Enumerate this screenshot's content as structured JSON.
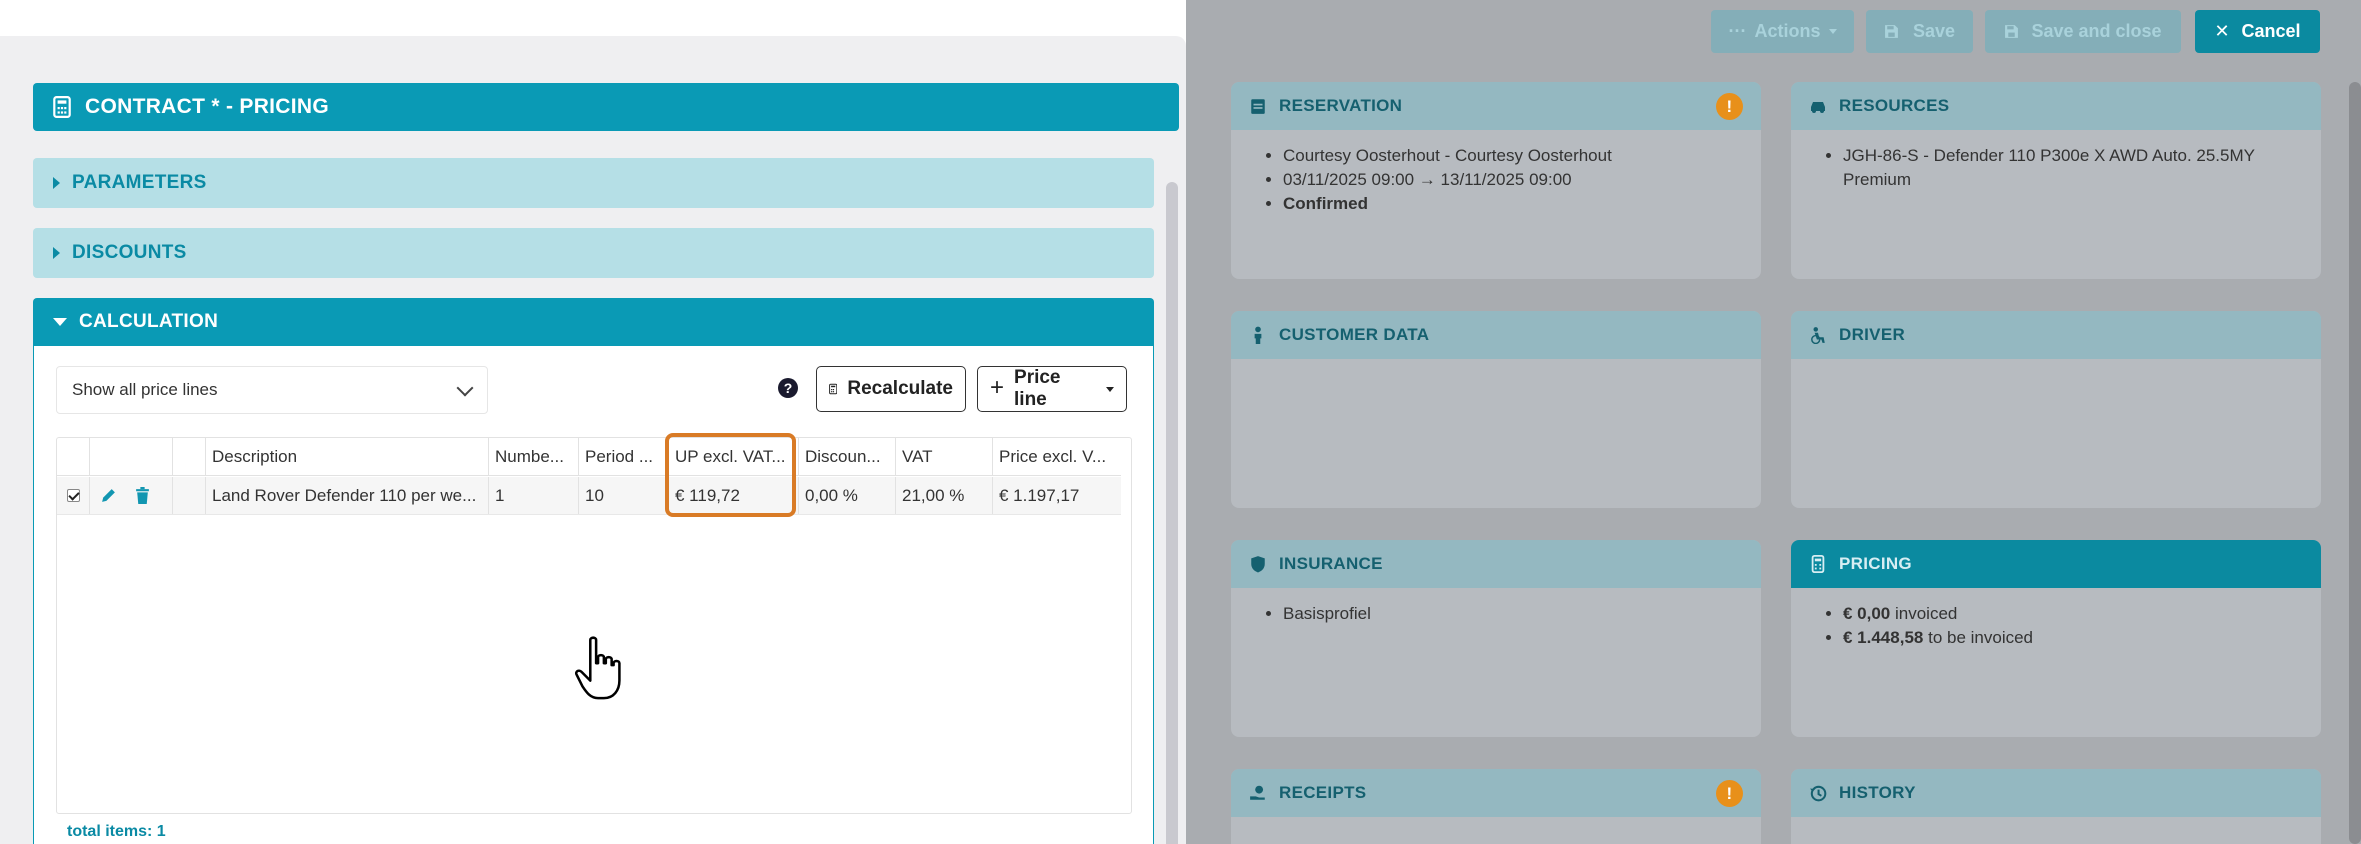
{
  "left": {
    "title": "CONTRACT * - PRICING",
    "sections": {
      "parameters": "PARAMETERS",
      "discounts": "DISCOUNTS",
      "calculation": "CALCULATION"
    },
    "filter_value": "Show all price lines",
    "buttons": {
      "recalculate": "Recalculate",
      "price_line": "Price line"
    },
    "help_symbol": "?",
    "table": {
      "headers": [
        "Description",
        "Numbe...",
        "Period ...",
        "UP excl. VAT...",
        "Discoun...",
        "VAT",
        "Price excl. V..."
      ],
      "rows": [
        {
          "checked": true,
          "description": "Land Rover Defender 110 per we...",
          "number": "1",
          "period": "10",
          "up_excl_vat": "€ 119,72",
          "discount": "0,00 %",
          "vat": "21,00 %",
          "price_excl_vat": "€ 1.197,17"
        }
      ]
    },
    "total_items": "total items: 1"
  },
  "right": {
    "toolbar": {
      "actions": "Actions",
      "save": "Save",
      "save_and_close": "Save and close",
      "cancel": "Cancel"
    },
    "cards": {
      "reservation": {
        "title": "RESERVATION",
        "items": [
          "Courtesy Oosterhout - Courtesy Oosterhout",
          "03/11/2025 09:00 → 13/11/2025 09:00",
          "Confirmed"
        ]
      },
      "resources": {
        "title": "RESOURCES",
        "items": [
          "JGH-86-S - Defender 110 P300e X AWD Auto. 25.5MY Premium"
        ]
      },
      "customer_data": {
        "title": "CUSTOMER DATA"
      },
      "driver": {
        "title": "DRIVER"
      },
      "insurance": {
        "title": "INSURANCE",
        "items": [
          "Basisprofiel"
        ]
      },
      "pricing": {
        "title": "PRICING",
        "invoiced_amount": "€ 0,00",
        "invoiced_label": "invoiced",
        "to_invoice_amount": "€ 1.448,58",
        "to_invoice_label": "to be invoiced"
      },
      "receipts": {
        "title": "RECEIPTS"
      },
      "history": {
        "title": "HISTORY"
      }
    },
    "warning_symbol": "!"
  },
  "colors": {
    "accent": "#0a9ab5",
    "accent_light": "#b5dfe6",
    "highlight": "#d97b26",
    "warning": "#e8901a",
    "overlay": "#a9acb0"
  }
}
